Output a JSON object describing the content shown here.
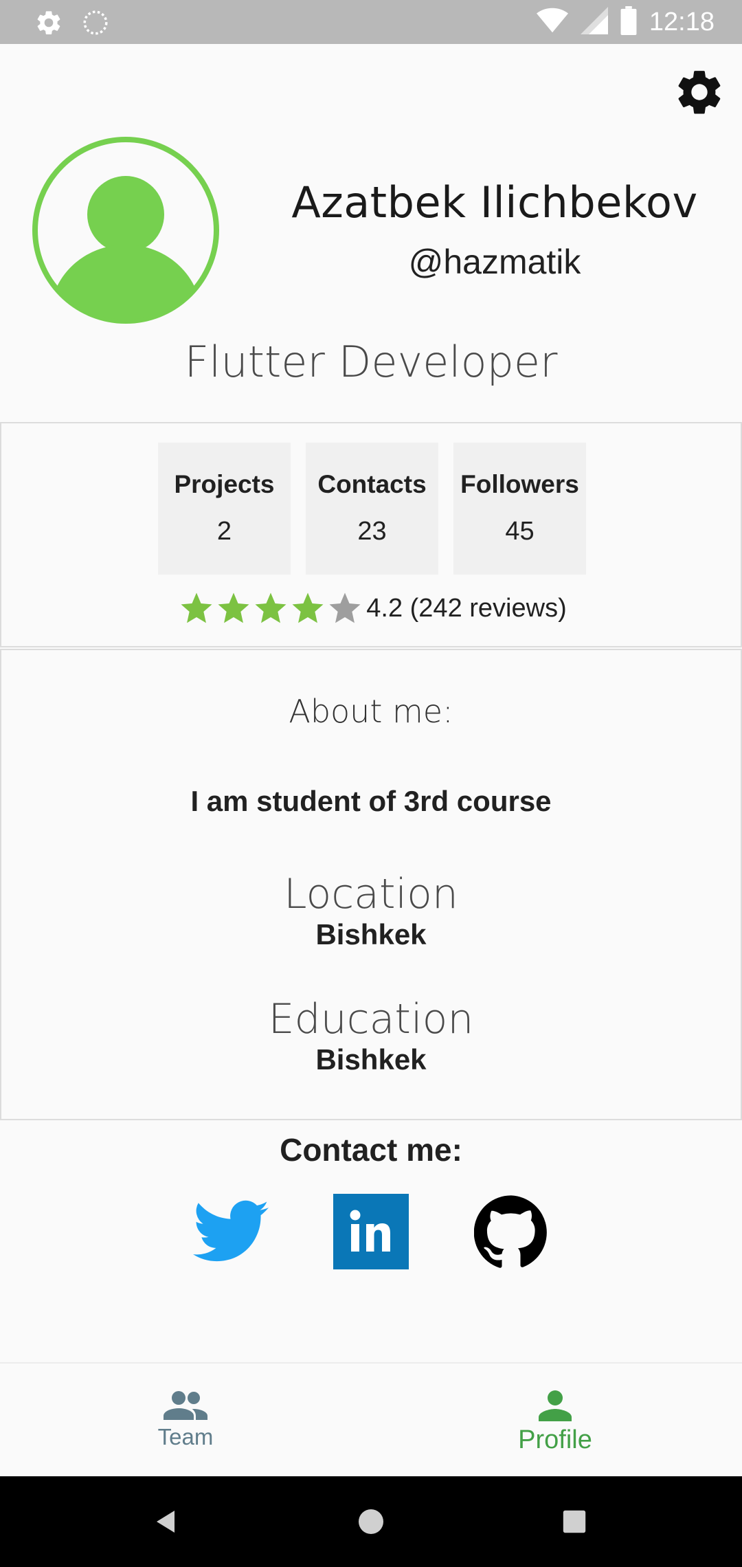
{
  "status_bar": {
    "time": "12:18",
    "icons": [
      "settings-icon",
      "sync-icon",
      "wifi-icon",
      "signal-icon",
      "battery-icon"
    ]
  },
  "profile": {
    "name": "Azatbek Ilichbekov",
    "handle": "@hazmatik",
    "role": "Flutter Developer",
    "accent_color": "#76d04f"
  },
  "stats": [
    {
      "label": "Projects",
      "value": "2"
    },
    {
      "label": "Contacts",
      "value": "23"
    },
    {
      "label": "Followers",
      "value": "45"
    }
  ],
  "rating": {
    "value": 4.2,
    "filled_stars": 4,
    "total_stars": 5,
    "text": "4.2 (242 reviews)",
    "star_color": "#7cc242",
    "empty_star_color": "#9e9e9e"
  },
  "about": {
    "title": "About me:",
    "text": "I am student of 3rd course",
    "location_title": "Location",
    "location_value": "Bishkek",
    "education_title": "Education",
    "education_value": "Bishkek"
  },
  "contact": {
    "title": "Contact me:",
    "links": [
      {
        "name": "twitter-icon",
        "color": "#1da1f2"
      },
      {
        "name": "linkedin-icon",
        "color": "#0a77b7"
      },
      {
        "name": "github-icon",
        "color": "#000000"
      }
    ]
  },
  "bottom_nav": {
    "items": [
      {
        "label": "Team",
        "icon": "group-icon",
        "color": "#607d8b",
        "active": false
      },
      {
        "label": "Profile",
        "icon": "person-icon",
        "color": "#43a047",
        "active": true
      }
    ]
  }
}
